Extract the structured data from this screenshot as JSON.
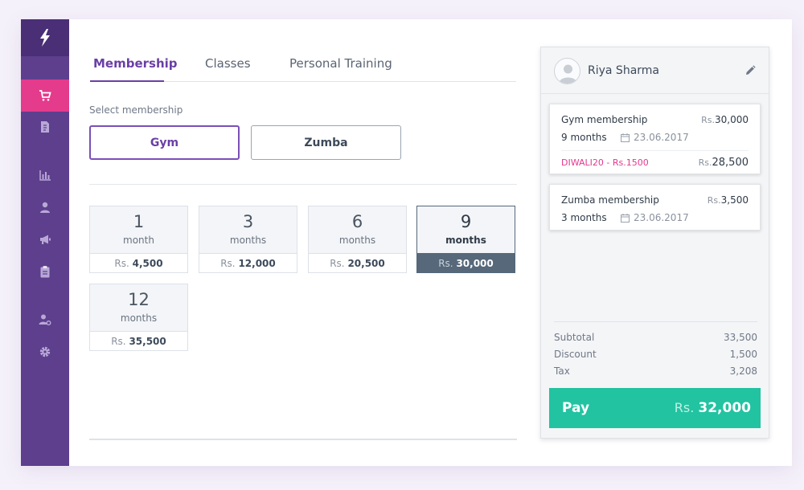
{
  "sidebar": {
    "items": [
      {
        "icon": "cart-icon",
        "active": true
      },
      {
        "icon": "invoice-icon"
      },
      {
        "icon": "bar-chart-icon"
      },
      {
        "icon": "user-icon"
      },
      {
        "icon": "megaphone-icon"
      },
      {
        "icon": "clipboard-icon"
      },
      {
        "icon": "user-settings-icon"
      },
      {
        "icon": "gear-icon"
      }
    ]
  },
  "tabs": [
    {
      "label": "Membership",
      "active": true
    },
    {
      "label": "Classes"
    },
    {
      "label": "Personal Training"
    }
  ],
  "select_label": "Select membership",
  "membership_types": [
    {
      "label": "Gym",
      "selected": true
    },
    {
      "label": "Zumba"
    }
  ],
  "plans": [
    {
      "count": "1",
      "unit": "month",
      "currency": "Rs.",
      "price": "4,500"
    },
    {
      "count": "3",
      "unit": "months",
      "currency": "Rs.",
      "price": "12,000"
    },
    {
      "count": "6",
      "unit": "months",
      "currency": "Rs.",
      "price": "20,500"
    },
    {
      "count": "9",
      "unit": "months",
      "currency": "Rs.",
      "price": "30,000",
      "selected": true
    },
    {
      "count": "12",
      "unit": "months",
      "currency": "Rs.",
      "price": "35,500"
    }
  ],
  "customer": {
    "name": "Riya Sharma"
  },
  "cart": [
    {
      "title": "Gym membership",
      "amount_prefix": "Rs.",
      "amount": "30,000",
      "duration": "9 months",
      "date": "23.06.2017",
      "coupon": "DIWALI20 - Rs.1500",
      "net_prefix": "Rs.",
      "net": "28,500"
    },
    {
      "title": "Zumba membership",
      "amount_prefix": "Rs.",
      "amount": "3,500",
      "duration": "3 months",
      "date": "23.06.2017"
    }
  ],
  "totals": {
    "subtotal_label": "Subtotal",
    "subtotal": "33,500",
    "discount_label": "Discount",
    "discount": "1,500",
    "tax_label": "Tax",
    "tax": "3,208"
  },
  "pay": {
    "label": "Pay",
    "currency": "Rs.",
    "amount": "32,000"
  },
  "colors": {
    "sidebar": "#5d3f8e",
    "sidebar_active": "#e43b8c",
    "accent": "#6a3fa5",
    "pay": "#22c3a1",
    "coupon": "#e4388e"
  }
}
